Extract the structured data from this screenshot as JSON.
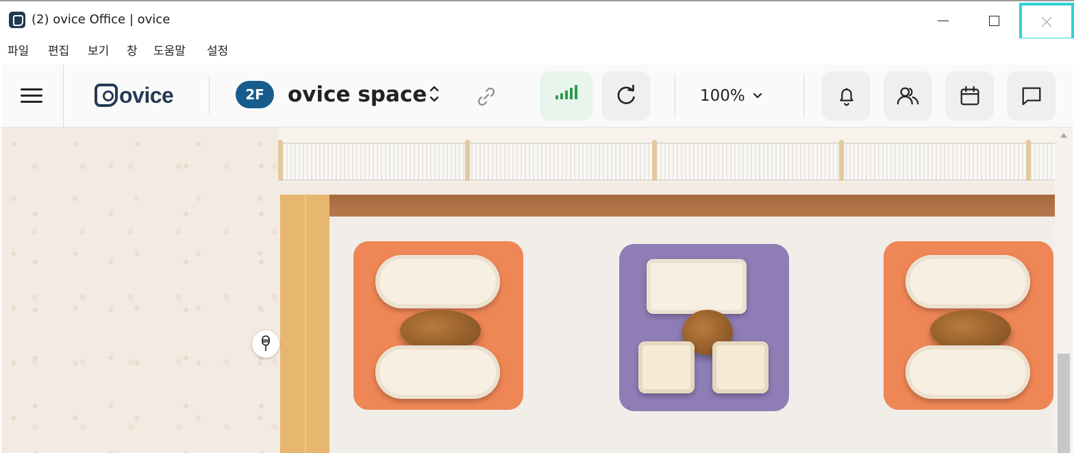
{
  "window": {
    "title": "(2)  ovice Office | ovice",
    "accent_color": "#33cfd6"
  },
  "menu": [
    "파일",
    "편집",
    "보기",
    "창",
    "도움말",
    "설정"
  ],
  "toolbar": {
    "logo_text": "ovice",
    "floor": "2F",
    "space_name": "ovice space",
    "zoom": "100%",
    "signal_color": "#2e9a4e",
    "floor_badge_color": "#175c8c"
  },
  "icons": {
    "menu": "hamburger-icon",
    "switch": "chevron-up-down-icon",
    "link": "link-icon",
    "signal": "signal-strength-icon",
    "refresh": "refresh-icon",
    "zoom": "chevron-down-icon",
    "notifications": "bell-icon",
    "members": "users-icon",
    "calendar": "calendar-icon",
    "chat": "chat-icon",
    "microphone": "microphone-icon"
  }
}
